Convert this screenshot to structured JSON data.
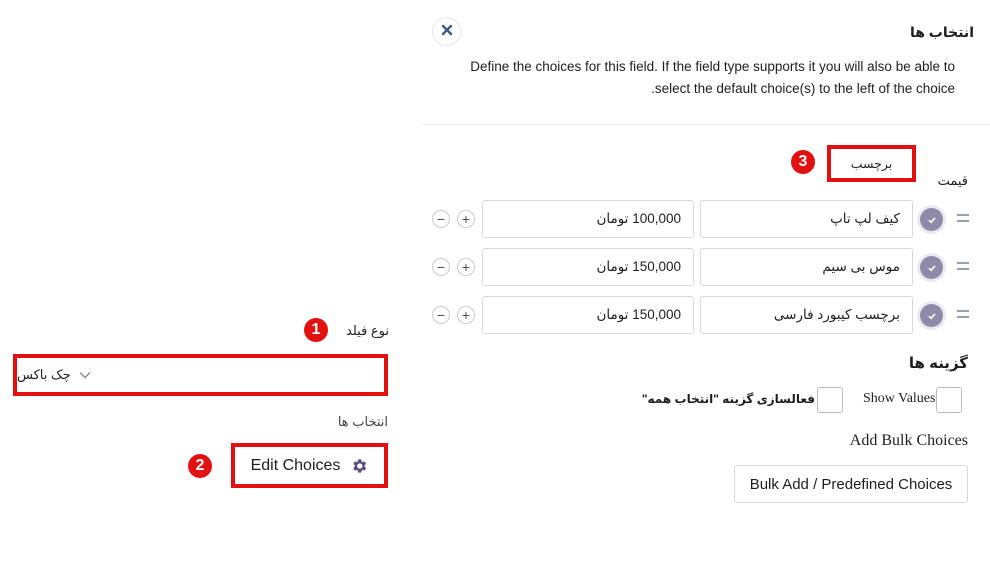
{
  "left_panel": {
    "field_type_label": "نوع فیلد",
    "field_type_value": "چک باکس",
    "choices_label": "انتخاب ها",
    "edit_choices_label": "Edit Choices"
  },
  "annotations": {
    "badge_1": "1",
    "badge_2": "2",
    "badge_3": "3",
    "highlight_color": "#e21010"
  },
  "right_panel": {
    "title": "انتخاب ها",
    "description_line1": "Define the choices for this field. If the field type supports it you will also be able to",
    "description_line2": ".select the default choice(s) to the left of the choice",
    "columns": {
      "label": "برچسب",
      "price": "قیمت"
    },
    "choices": [
      {
        "label": "کیف لپ تاپ",
        "price": "100,000 تومان",
        "selected": true
      },
      {
        "label": "موس بی سیم",
        "price": "150,000 تومان",
        "selected": true
      },
      {
        "label": "برچسب کیبورد فارسی",
        "price": "150,000 تومان",
        "selected": true
      }
    ],
    "options_title": "گزینه ها",
    "show_values_label": "Show Values",
    "show_values_checked": false,
    "select_all_label": "فعالسازی گزینه \"انتخاب همه\"",
    "select_all_checked": false,
    "bulk_title": "Add Bulk Choices",
    "bulk_button_label": "Bulk Add / Predefined Choices"
  },
  "icons": {
    "close": "close-icon",
    "gear": "gear-icon",
    "chevron": "chevron-down-icon",
    "drag": "drag-handle-icon",
    "check": "check-icon",
    "plus": "plus-icon",
    "minus": "minus-icon"
  }
}
